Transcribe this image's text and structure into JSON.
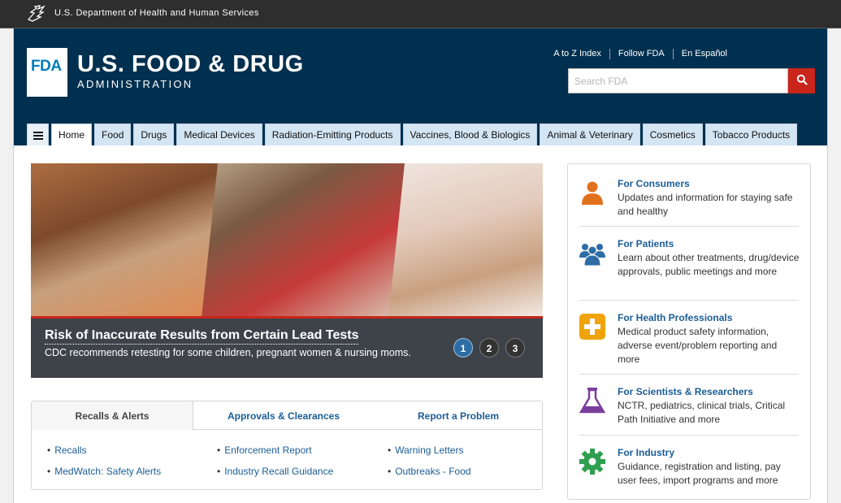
{
  "hhs_bar": {
    "text": "U.S. Department of Health and Human Services"
  },
  "header": {
    "logo_mark": "FDA",
    "title": "U.S. FOOD & DRUG",
    "subtitle": "ADMINISTRATION",
    "util_links": [
      "A to Z Index",
      "Follow FDA",
      "En Español"
    ],
    "search": {
      "placeholder": "Search FDA"
    }
  },
  "nav": {
    "tabs": [
      "Home",
      "Food",
      "Drugs",
      "Medical Devices",
      "Radiation-Emitting Products",
      "Vaccines, Blood & Biologics",
      "Animal & Veterinary",
      "Cosmetics",
      "Tobacco Products"
    ],
    "active": "Home"
  },
  "carousel": {
    "title": "Risk of Inaccurate Results from Certain Lead Tests",
    "subtitle": "CDC recommends retesting for some children, pregnant women & nursing moms.",
    "pages": [
      "1",
      "2",
      "3"
    ],
    "active_page": "1"
  },
  "info_tabs": {
    "tabs": [
      "Recalls & Alerts",
      "Approvals & Clearances",
      "Report a Problem"
    ],
    "active": "Recalls & Alerts",
    "links": [
      "Recalls",
      "Enforcement Report",
      "Warning Letters",
      "MedWatch: Safety Alerts",
      "Industry Recall Guidance",
      "Outbreaks - Food"
    ]
  },
  "sidebar": {
    "items": [
      {
        "title": "For Consumers",
        "desc": "Updates and information for staying safe and healthy",
        "icon": "person-icon",
        "color": "#e2711d"
      },
      {
        "title": "For Patients",
        "desc": "Learn about other treatments, drug/device approvals, public meetings and more",
        "icon": "group-icon",
        "color": "#2e6da4"
      },
      {
        "title": "For Health Professionals",
        "desc": "Medical product safety information, adverse event/problem reporting and more",
        "icon": "plus-icon",
        "color": "#f0a30a"
      },
      {
        "title": "For Scientists & Researchers",
        "desc": "NCTR, pediatrics, clinical trials, Critical Path Initiative and more",
        "icon": "flask-icon",
        "color": "#7a3f9d"
      },
      {
        "title": "For Industry",
        "desc": "Guidance, registration and listing, pay user fees, import programs and more",
        "icon": "gear-icon",
        "color": "#2e9e4f"
      }
    ]
  },
  "colors": {
    "header_bg": "#00304f",
    "accent_red": "#c9251a",
    "link_blue": "#1b5d96",
    "nav_tab_bg": "#d4e5f3"
  }
}
